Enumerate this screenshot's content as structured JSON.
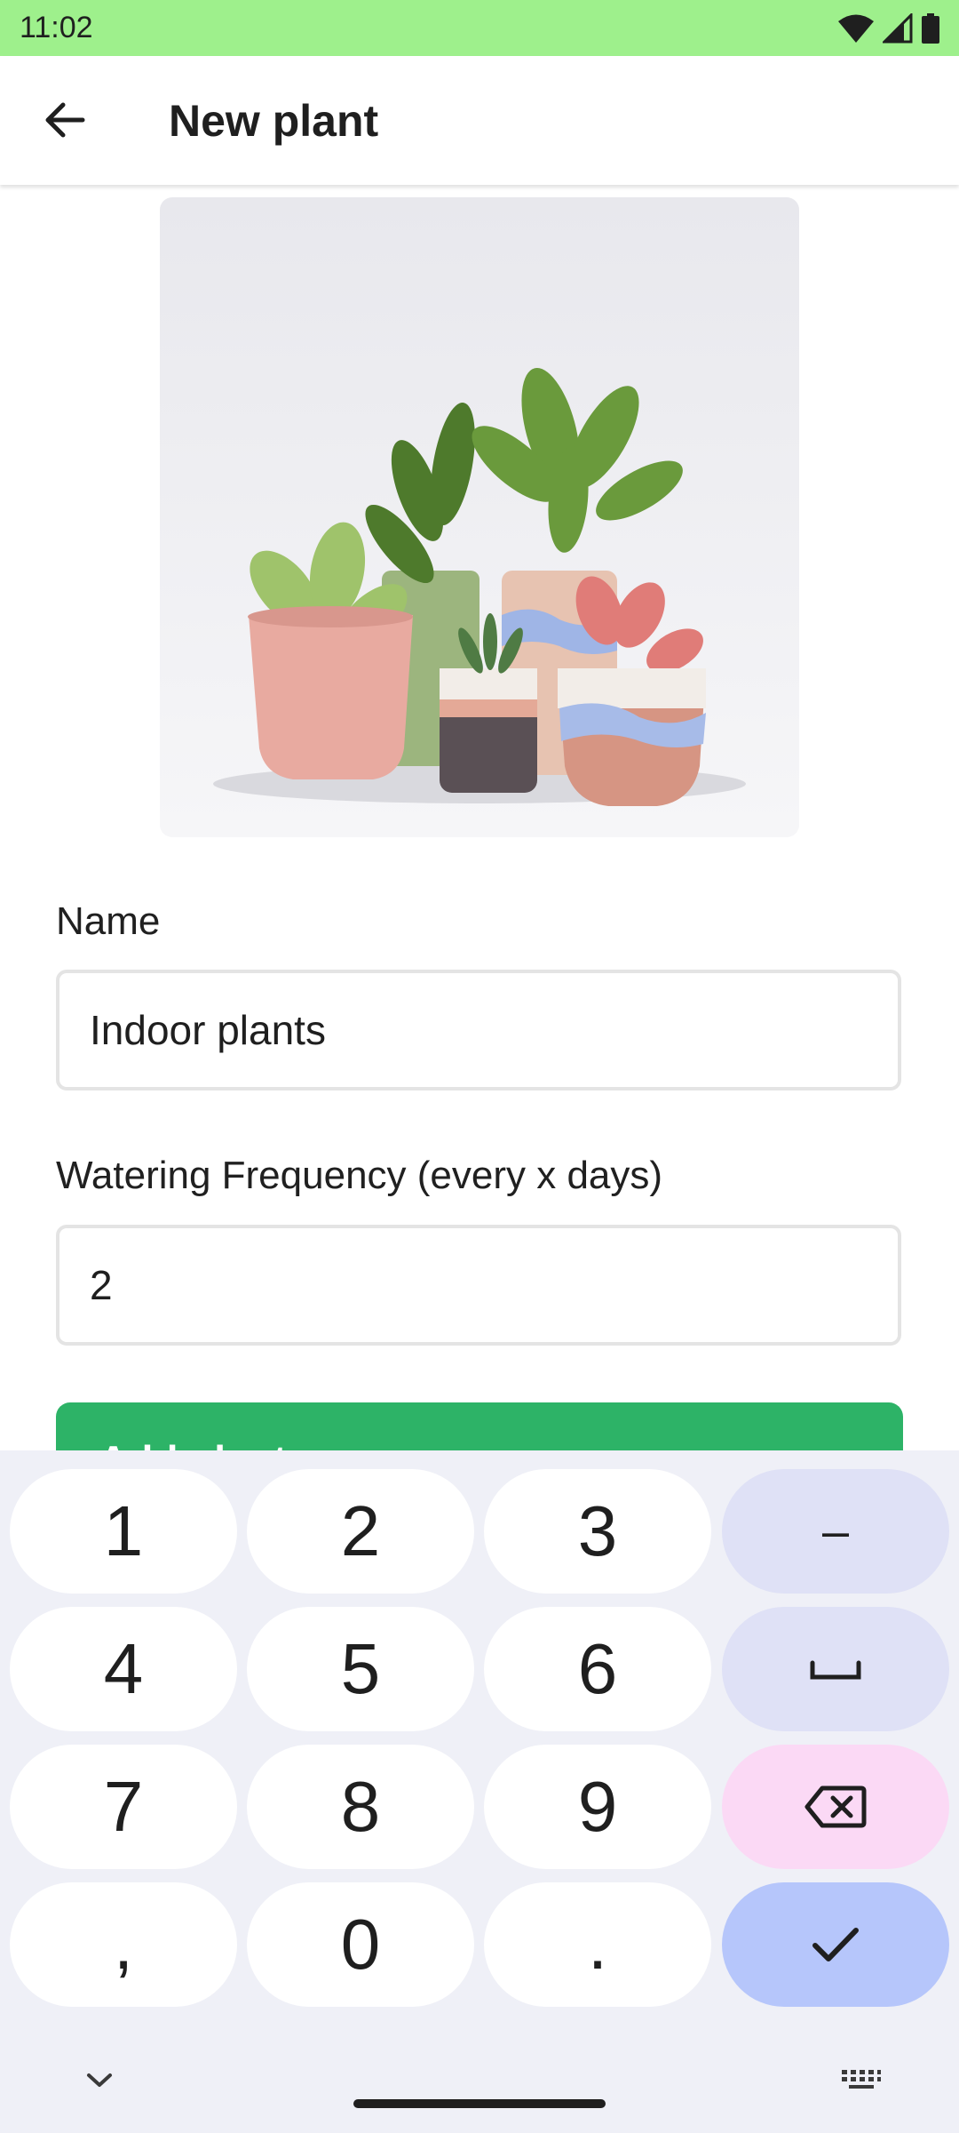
{
  "status_bar": {
    "time": "11:02",
    "background": "#9ef08c"
  },
  "app_bar": {
    "title": "New plant",
    "back_icon": "arrow-back-icon"
  },
  "form": {
    "name_label": "Name",
    "name_value": "Indoor plants",
    "frequency_label": "Watering Frequency (every x days)",
    "frequency_value": "2",
    "submit_label": "Add plant",
    "accent": "#2db367"
  },
  "keyboard": {
    "keys": [
      [
        "1",
        "2",
        "3",
        "–"
      ],
      [
        "4",
        "5",
        "6",
        "space"
      ],
      [
        "7",
        "8",
        "9",
        "backspace"
      ],
      [
        ",",
        "0",
        ".",
        "done"
      ]
    ],
    "hide_icon": "chevron-down-icon",
    "switch_icon": "keyboard-icon"
  }
}
